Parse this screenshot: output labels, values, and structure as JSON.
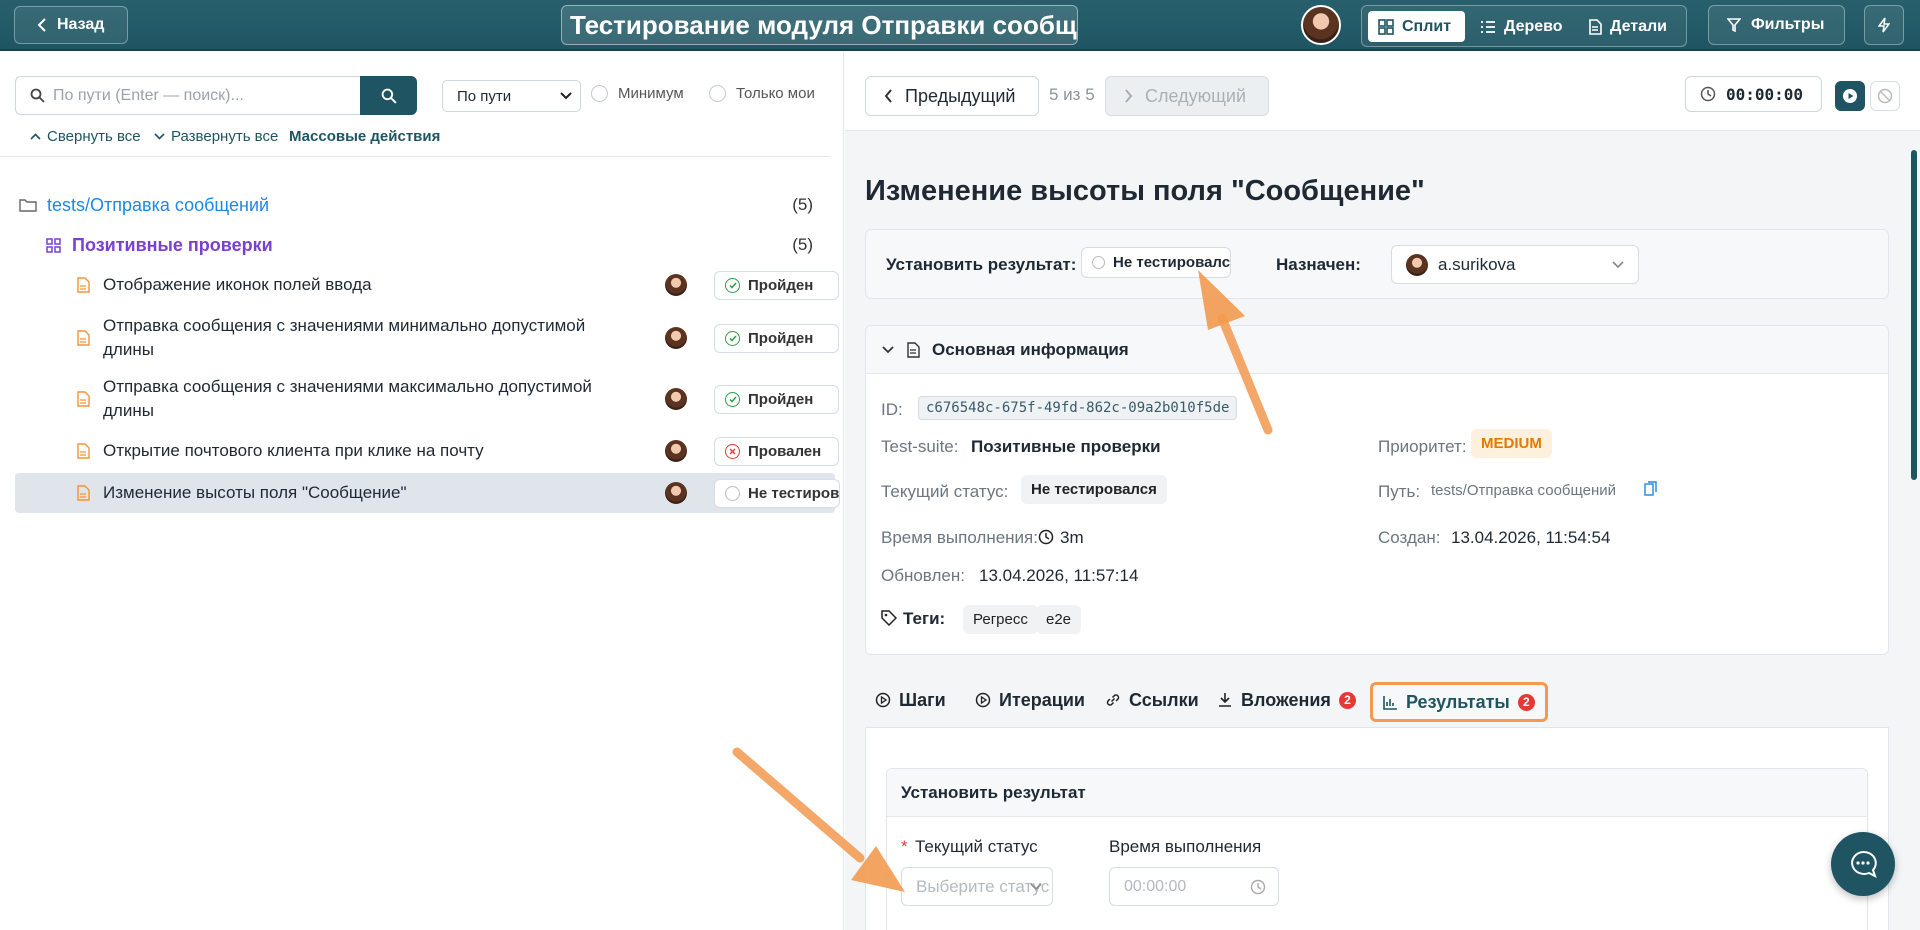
{
  "topbar": {
    "back_label": "Назад",
    "title": "Тестирование модуля Отправки сообще...",
    "views": {
      "split": "Сплит",
      "tree": "Дерево",
      "details": "Детали"
    },
    "filters_label": "Фильтры"
  },
  "left": {
    "search_placeholder": "По пути (Enter — поиск)...",
    "sort_select": "По пути",
    "check_min": "Минимум",
    "check_mine": "Только мои",
    "collapse_all": "Свернуть все",
    "expand_all": "Развернуть все",
    "bulk_actions": "Массовые действия",
    "folder": {
      "name": "tests/Отправка сообщений",
      "count": "(5)"
    },
    "suite": {
      "name": "Позитивные проверки",
      "count": "(5)"
    },
    "cases": [
      {
        "title": "Отображение иконок полей ввода",
        "status": "Пройден"
      },
      {
        "title": "Отправка сообщения с значениями минимально допустимой длины",
        "status": "Пройден"
      },
      {
        "title": "Отправка сообщения с значениями максимально допустимой длины",
        "status": "Пройден"
      },
      {
        "title": "Открытие почтового клиента при клике на почту",
        "status": "Провален"
      },
      {
        "title": "Изменение высоты поля \"Сообщение\"",
        "status": "Не тестирован"
      }
    ]
  },
  "right": {
    "prev_label": "Предыдущий",
    "position": "5 из 5",
    "next_label": "Следующий",
    "timer": "00:00:00",
    "heading": "Изменение высоты поля \"Сообщение\"",
    "set_result_label": "Установить результат:",
    "set_result_value": "Не тестировался",
    "assigned_label": "Назначен:",
    "assignee": "a.surikova",
    "info": {
      "section_title": "Основная информация",
      "id_label": "ID:",
      "id_value": "c676548c-675f-49fd-862c-09a2b010f5de",
      "suite_label": "Test-suite:",
      "suite_value": "Позитивные проверки",
      "priority_label": "Приоритет:",
      "priority_value": "MEDIUM",
      "status_label": "Текущий статус:",
      "status_value": "Не тестировался",
      "path_label": "Путь:",
      "path_value": "tests/Отправка сообщений",
      "duration_label": "Время выполнения:",
      "duration_value": "3m",
      "created_label": "Создан:",
      "created_value": "13.04.2026, 11:54:54",
      "updated_label": "Обновлен:",
      "updated_value": "13.04.2026, 11:57:14",
      "tags_label": "Теги:",
      "tags": [
        "Регресс",
        "e2e"
      ]
    },
    "tabs": {
      "steps": "Шаги",
      "iterations": "Итерации",
      "links": "Ссылки",
      "attachments": "Вложения",
      "attachments_count": "2",
      "results": "Результаты",
      "results_count": "2"
    },
    "result_form": {
      "title": "Установить результат",
      "required_mark": "*",
      "status_label": "Текущий статус",
      "status_placeholder": "Выберите статус",
      "duration_label": "Время выполнения",
      "duration_placeholder": "00:00:00"
    }
  },
  "colors": {
    "brand": "#1f5562",
    "link": "#1e88e5",
    "suite": "#7b3fd1",
    "pass": "#2e9d4a",
    "fail": "#e53935",
    "accent_arrow": "#f29a4f",
    "medium": "#e07b00"
  }
}
